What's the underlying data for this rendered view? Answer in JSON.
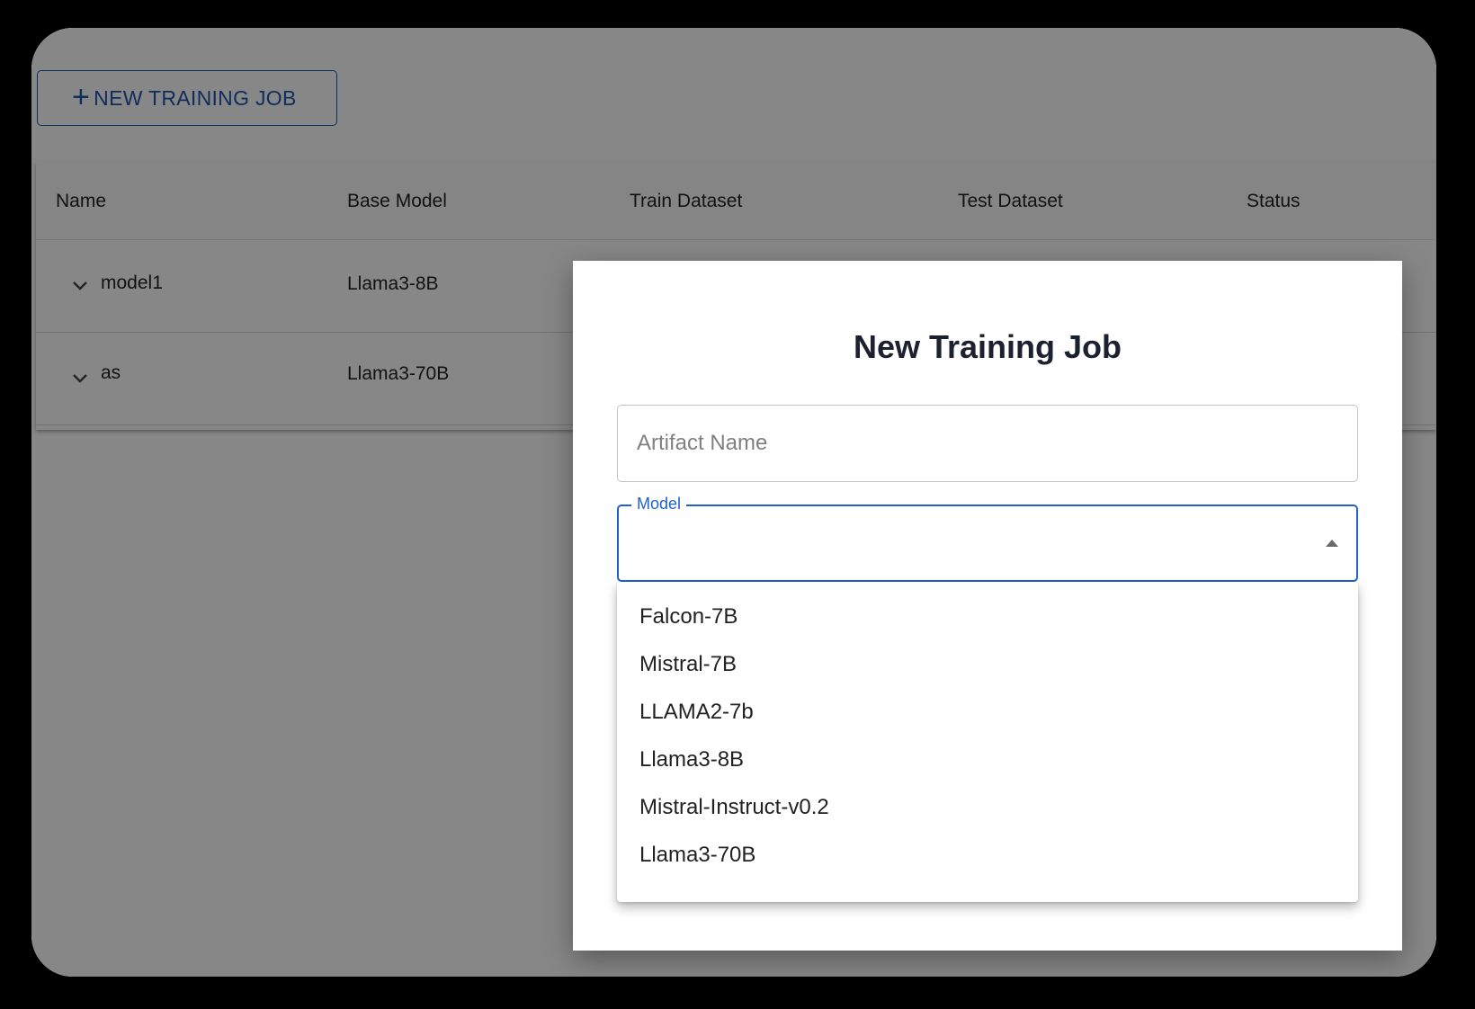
{
  "toolbar": {
    "new_job_label": "NEW TRAINING JOB"
  },
  "table": {
    "columns": [
      "Name",
      "Base Model",
      "Train Dataset",
      "Test Dataset",
      "Status"
    ],
    "rows": [
      {
        "name": "model1",
        "base_model": "Llama3-8B"
      },
      {
        "name": "as",
        "base_model": "Llama3-70B"
      }
    ]
  },
  "dialog": {
    "title": "New Training Job",
    "artifact_placeholder": "Artifact Name",
    "model_label": "Model",
    "model_options": [
      "Falcon-7B",
      "Mistral-7B",
      "LLAMA2-7b",
      "Llama3-8B",
      "Mistral-Instruct-v0.2",
      "Llama3-70B"
    ]
  },
  "colors": {
    "primary": "#1e62c8",
    "overlay": "rgba(0,0,0,0.47)"
  }
}
